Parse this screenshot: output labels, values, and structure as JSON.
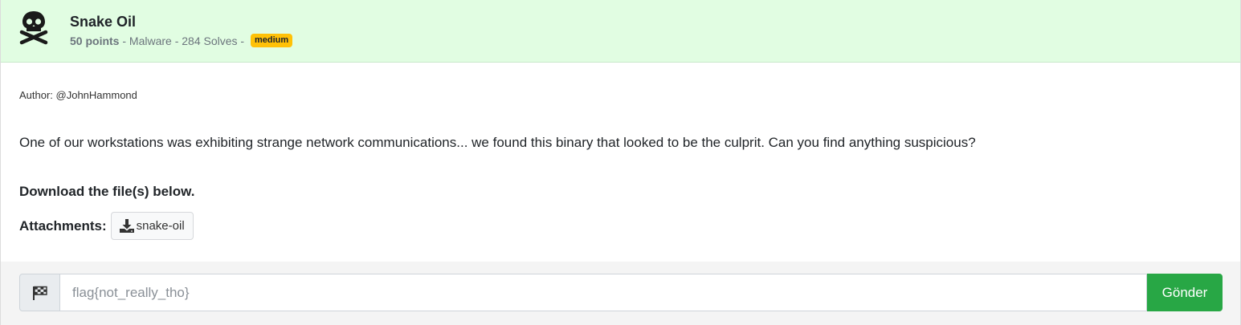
{
  "challenge": {
    "icon": "skull-crossbones-icon",
    "title": "Snake Oil",
    "points": "50 points",
    "meta_rest": " - Malware - 284 Solves - ",
    "difficulty": "medium"
  },
  "body": {
    "author": "Author: @JohnHammond",
    "description": "One of our workstations was exhibiting strange network communications... we found this binary that looked to be the culprit. Can you find anything suspicious?",
    "download_title": "Download the file(s) below.",
    "attachments_label": "Attachments:",
    "attachments": [
      {
        "icon": "download-icon",
        "name": "snake-oil"
      }
    ]
  },
  "submit": {
    "icon": "flag-checkered-icon",
    "placeholder": "flag{not_really_tho}",
    "value": "",
    "button_label": "Gönder"
  },
  "colors": {
    "header_bg": "#e1fde2",
    "badge": "#ffc107",
    "submit_button": "#28a745"
  }
}
